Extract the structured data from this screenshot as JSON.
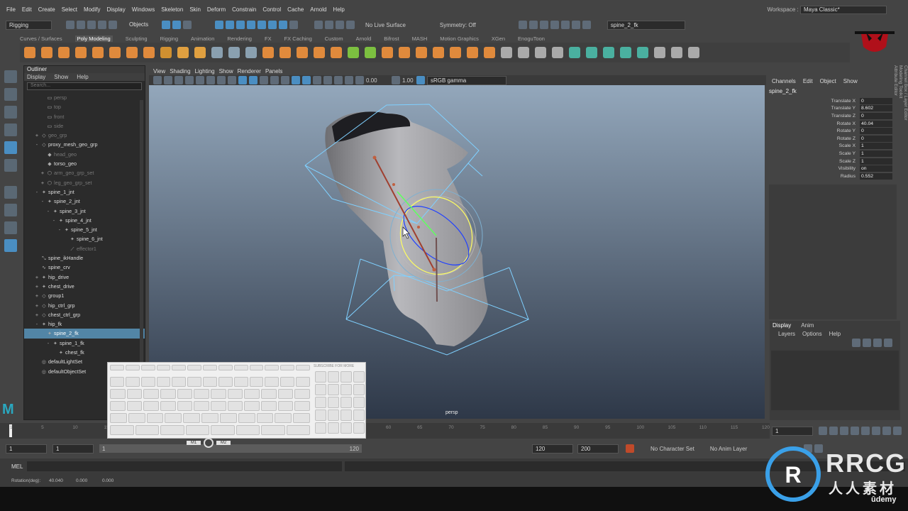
{
  "menubar": {
    "items": [
      "File",
      "Edit",
      "Create",
      "Select",
      "Modify",
      "Display",
      "Windows",
      "Skeleton",
      "Skin",
      "Deform",
      "Constrain",
      "Control",
      "Cache",
      "Arnold",
      "Help"
    ],
    "workspace_label": "Workspace :",
    "workspace_value": "Maya Classic*"
  },
  "statusline": {
    "menuset": "Rigging",
    "selection_mode": "Objects",
    "live_surface": "No Live Surface",
    "symmetry": "Symmetry: Off",
    "name_field": "spine_2_fk"
  },
  "shelf_tabs": [
    "Curves / Surfaces",
    "Poly Modeling",
    "Sculpting",
    "Rigging",
    "Animation",
    "Rendering",
    "FX",
    "FX Caching",
    "Custom",
    "Arnold",
    "Bifrost",
    "MASH",
    "Motion Graphics",
    "XGen",
    "EnoguToon"
  ],
  "shelf_active": "Poly Modeling",
  "outliner": {
    "title": "Outliner",
    "menu": [
      "Display",
      "Show",
      "Help"
    ],
    "search_placeholder": "Search...",
    "items": [
      {
        "label": "persp",
        "indent": 1,
        "type": "cam",
        "dim": true
      },
      {
        "label": "top",
        "indent": 1,
        "type": "cam",
        "dim": true
      },
      {
        "label": "front",
        "indent": 1,
        "type": "cam",
        "dim": true
      },
      {
        "label": "side",
        "indent": 1,
        "type": "cam",
        "dim": true
      },
      {
        "label": "geo_grp",
        "indent": 0,
        "type": "grp",
        "dim": true,
        "expand": "+"
      },
      {
        "label": "proxy_mesh_geo_grp",
        "indent": 0,
        "type": "grp",
        "expand": "-"
      },
      {
        "label": "head_geo",
        "indent": 1,
        "type": "mesh",
        "dim": true
      },
      {
        "label": "torso_geo",
        "indent": 1,
        "type": "mesh"
      },
      {
        "label": "arm_geo_grp_set",
        "indent": 1,
        "type": "set",
        "dim": true,
        "expand": "+"
      },
      {
        "label": "leg_geo_grp_set",
        "indent": 1,
        "type": "set",
        "dim": true,
        "expand": "+"
      },
      {
        "label": "spine_1_jnt",
        "indent": 0,
        "type": "jnt",
        "expand": "-"
      },
      {
        "label": "spine_2_jnt",
        "indent": 1,
        "type": "jnt",
        "expand": "-"
      },
      {
        "label": "spine_3_jnt",
        "indent": 2,
        "type": "jnt",
        "expand": "-"
      },
      {
        "label": "spine_4_jnt",
        "indent": 3,
        "type": "jnt",
        "expand": "-"
      },
      {
        "label": "spine_5_jnt",
        "indent": 4,
        "type": "jnt",
        "expand": "-"
      },
      {
        "label": "spine_6_jnt",
        "indent": 5,
        "type": "jnt"
      },
      {
        "label": "effector1",
        "indent": 5,
        "type": "eff",
        "dim": true
      },
      {
        "label": "spine_ikHandle",
        "indent": 0,
        "type": "ik"
      },
      {
        "label": "spine_crv",
        "indent": 0,
        "type": "crv"
      },
      {
        "label": "hip_drive",
        "indent": 0,
        "type": "jnt",
        "expand": "+"
      },
      {
        "label": "chest_drive",
        "indent": 0,
        "type": "jnt",
        "expand": "+"
      },
      {
        "label": "group1",
        "indent": 0,
        "type": "grp",
        "expand": "+"
      },
      {
        "label": "hip_ctrl_grp",
        "indent": 0,
        "type": "grp",
        "expand": "+"
      },
      {
        "label": "chest_ctrl_grp",
        "indent": 0,
        "type": "grp",
        "expand": "+"
      },
      {
        "label": "hip_fk",
        "indent": 0,
        "type": "jnt",
        "expand": "-"
      },
      {
        "label": "spine_2_fk",
        "indent": 1,
        "type": "jnt",
        "selected": true
      },
      {
        "label": "spine_1_fk",
        "indent": 2,
        "type": "jnt",
        "expand": "-"
      },
      {
        "label": "chest_fk",
        "indent": 3,
        "type": "jnt"
      },
      {
        "label": "defaultLightSet",
        "indent": 0,
        "type": "sets"
      },
      {
        "label": "defaultObjectSet",
        "indent": 0,
        "type": "sets"
      }
    ]
  },
  "viewport": {
    "menu": [
      "View",
      "Shading",
      "Lighting",
      "Show",
      "Renderer",
      "Panels"
    ],
    "field_a": "0.00",
    "field_b": "1.00",
    "colorspace": "sRGB gamma",
    "camera": "persp"
  },
  "channelbox": {
    "menu": [
      "Channels",
      "Edit",
      "Object",
      "Show"
    ],
    "object": "spine_2_fk",
    "attrs": [
      {
        "name": "Translate X",
        "value": "0"
      },
      {
        "name": "Translate Y",
        "value": "8.602"
      },
      {
        "name": "Translate Z",
        "value": "0"
      },
      {
        "name": "Rotate X",
        "value": "40.04"
      },
      {
        "name": "Rotate Y",
        "value": "0"
      },
      {
        "name": "Rotate Z",
        "value": "0"
      },
      {
        "name": "Scale X",
        "value": "1"
      },
      {
        "name": "Scale Y",
        "value": "1"
      },
      {
        "name": "Scale Z",
        "value": "1"
      },
      {
        "name": "Visibility",
        "value": "on"
      },
      {
        "name": "Radius",
        "value": "0.552"
      }
    ],
    "side_tabs": [
      "Channel Box / Layer Editor",
      "Modeling Toolkit",
      "Attribute Editor"
    ]
  },
  "layers": {
    "tabs": [
      "Display",
      "Anim"
    ],
    "menu": [
      "Layers",
      "Options",
      "Help"
    ]
  },
  "timeline": {
    "ticks": [
      "1",
      "5",
      "10",
      "15",
      "20",
      "25",
      "30",
      "35",
      "40",
      "45",
      "50",
      "55",
      "60",
      "65",
      "70",
      "75",
      "80",
      "85",
      "90",
      "95",
      "100",
      "105",
      "110",
      "115",
      "120"
    ],
    "current": "1"
  },
  "range": {
    "start": "1",
    "inner_start": "1",
    "slider_start": "1",
    "slider_end": "120",
    "end": "120",
    "outer_end": "200",
    "char_set": "No Character Set",
    "anim_layer": "No Anim Layer"
  },
  "cmdline": {
    "label": "MEL"
  },
  "helpline": {
    "text": "Rotation(deg):",
    "v1": "40.040",
    "v2": "0.000",
    "v3": "0.000"
  },
  "keyboard_overlay": {
    "subscribe": "SUBSCRIBE FOR MORE",
    "mouse_left": "M1",
    "mouse_right": "M2"
  },
  "watermark": {
    "brand": "RRCG",
    "sub": "人人素材",
    "udemy": "ûdemy",
    "logo_text": "SCORPION"
  }
}
